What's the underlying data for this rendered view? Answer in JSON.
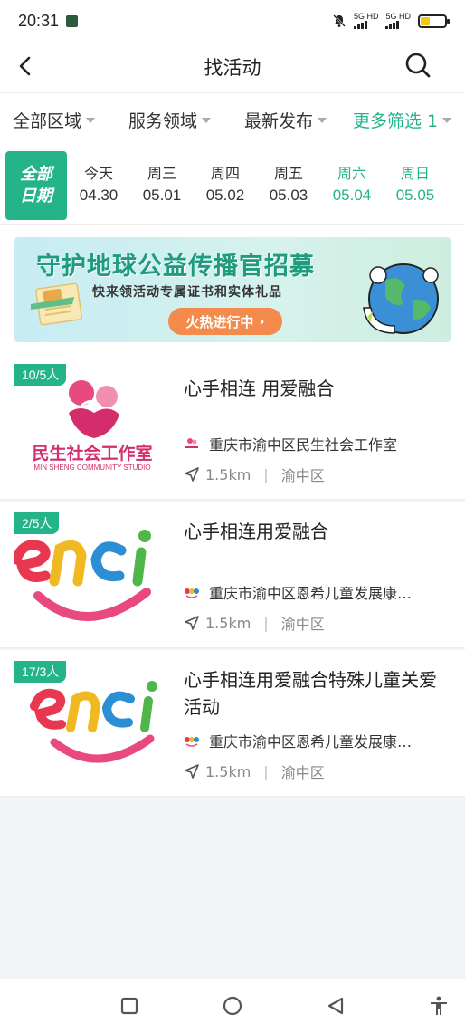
{
  "status_bar": {
    "time": "20:31",
    "sim1": "5G HD",
    "sim2": "5G HD",
    "icons": [
      "app-notification-icon",
      "mute-icon",
      "signal-icon",
      "signal-icon",
      "battery-icon"
    ],
    "battery_color": "#f5c518"
  },
  "header": {
    "title": "找活动",
    "icons": [
      "back-icon",
      "search-icon"
    ]
  },
  "filters": {
    "area": "全部区域",
    "service": "服务领域",
    "sort": "最新发布",
    "more": "更多筛选 1"
  },
  "dates": {
    "all_label_1": "全部",
    "all_label_2": "日期",
    "items": [
      {
        "weekday": "今天",
        "date": "04.30"
      },
      {
        "weekday": "周三",
        "date": "05.01"
      },
      {
        "weekday": "周四",
        "date": "05.02"
      },
      {
        "weekday": "周五",
        "date": "05.03"
      },
      {
        "weekday": "周六",
        "date": "05.04"
      },
      {
        "weekday": "周日",
        "date": "05.05"
      }
    ]
  },
  "banner": {
    "title": "守护地球公益传播官招募",
    "subtitle": "快来领活动专属证书和实体礼品",
    "button": "火热进行中",
    "cert_text": "守护地球"
  },
  "activities": [
    {
      "badge": "10/5人",
      "title": "心手相连 用爱融合",
      "org": "重庆市渝中区民生社会工作室",
      "distance": "1.5km",
      "district": "渝中区",
      "logo_text": "民生社会工作室",
      "logo_sub": "MIN SHENG COMMUNITY STUDIO"
    },
    {
      "badge": "2/5人",
      "title": "心手相连用爱融合",
      "org": "重庆市渝中区恩希儿童发展康…",
      "distance": "1.5km",
      "district": "渝中区"
    },
    {
      "badge": "17/3人",
      "title": "心手相连用爱融合特殊儿童关爱活动",
      "org": "重庆市渝中区恩希儿童发展康…",
      "distance": "1.5km",
      "district": "渝中区"
    }
  ],
  "colors": {
    "accent": "#25b48a",
    "banner_button": "#f48a4b",
    "background": "#f2f3f5"
  },
  "nav_bar": {
    "icons": [
      "square-recents-icon",
      "circle-home-icon",
      "triangle-back-icon",
      "accessibility-icon"
    ]
  }
}
